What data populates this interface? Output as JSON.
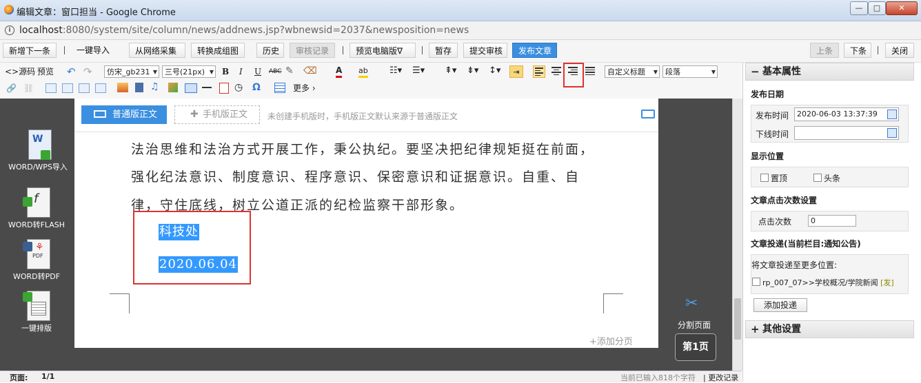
{
  "window": {
    "title": "编辑文章：窗口担当 - Google Chrome",
    "minimize": "—",
    "maximize": "□",
    "close": "✕"
  },
  "address": {
    "host": "localhost",
    "path": ":8080/system/site/column/news/addnews.jsp?wbnewsid=2037&newsposition=news"
  },
  "toolbar": {
    "new_next": "新增下一条",
    "import": "一键导入",
    "web_collect": "从网络采集",
    "convert_group": "转换成组图",
    "history": "历史",
    "audit_log": "审核记录",
    "preview_pc": "预览电脑版∇",
    "save_draft": "暂存",
    "submit_audit": "提交审核",
    "publish": "发布文章",
    "prev": "上条",
    "next": "下条",
    "close": "关闭"
  },
  "editor_toolbar": {
    "source": "<>源码",
    "preview": "预览",
    "font_family": "仿宋_gb231",
    "font_size": "三号(21px)",
    "bold": "B",
    "italic": "I",
    "underline": "U",
    "strike": "ABC",
    "title_style": "自定义标题",
    "paragraph": "段落",
    "more": "更多",
    "omega": "Ω",
    "font_color": "A",
    "bg_color": "ab"
  },
  "mode": {
    "normal": "普通版正文",
    "mobile": "手机版正文",
    "tip": "未创建手机版时，手机版正文默认来源于普通版正文"
  },
  "document": {
    "lines": [
      "法治思维和法治方式开展工作，秉公执纪。要坚决把纪律规矩挺在前面，",
      "强化纪法意识、制度意识、程序意识、保密意识和证据意识。自重、自",
      "律，守住底线，树立公道正派的纪检监察干部形象。"
    ],
    "sign_dept": "科技处 ",
    "sign_date": "2020.06.04",
    "add_page": "+添加分页"
  },
  "side_tools": [
    {
      "label": "WORD/WPS导入"
    },
    {
      "label": "WORD转FLASH"
    },
    {
      "label": "WORD转PDF"
    },
    {
      "label": "一键排版"
    }
  ],
  "paging": {
    "split": "分割页面",
    "page_no": "第1页"
  },
  "right_panel": {
    "basic_title": "基本属性",
    "publish_date_title": "发布日期",
    "publish_time_label": "发布时间",
    "publish_time_value": "2020-06-03 13:37:39",
    "offline_time_label": "下线时间",
    "offline_time_value": "",
    "display_title": "显示位置",
    "top_label": "置顶",
    "headline_label": "头条",
    "clicks_title": "文章点击次数设置",
    "clicks_label": "点击次数",
    "clicks_value": "0",
    "deliver_title": "文章投递(当前栏目:通知公告)",
    "deliver_more": "将文章投递至更多位置:",
    "deliver_item": "rp_007_07>>学校概况/学院新闻",
    "deliver_tag": "[发]",
    "add_deliver": "添加投递",
    "other_title": "其他设置"
  },
  "status": {
    "page_label": "页面:",
    "page_value": "1/1",
    "count": "当前已输入818个字符",
    "change_log": "| 更改记录"
  }
}
